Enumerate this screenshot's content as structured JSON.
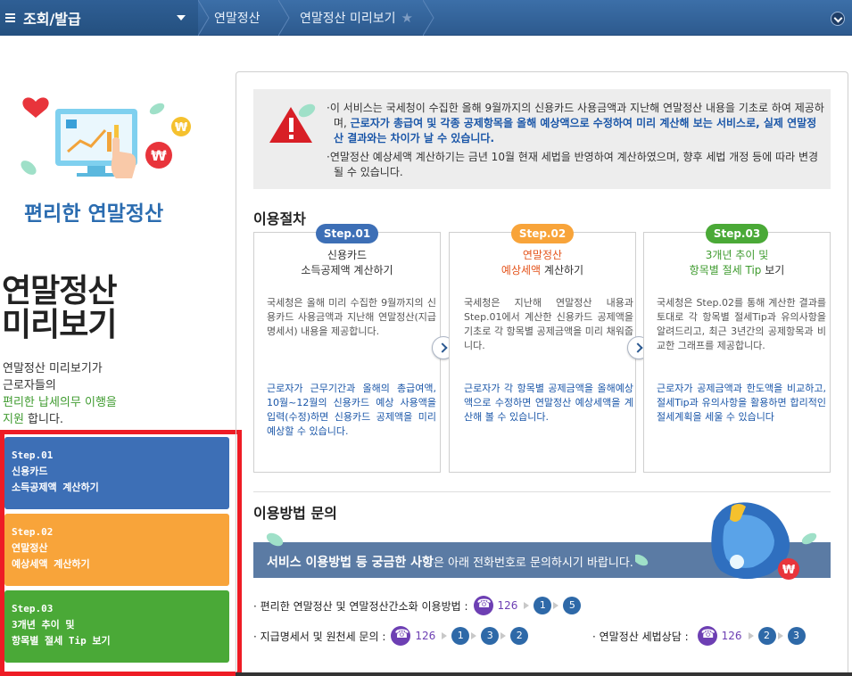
{
  "topbar": {
    "menu_title": "조회/발급",
    "breadcrumbs": [
      "연말정산",
      "연말정산 미리보기"
    ]
  },
  "left": {
    "subtitle": "편리한 연말정산",
    "title_line1": "연말정산",
    "title_line2": "미리보기",
    "desc_line1": "연말정산 미리보기가",
    "desc_line2": "근로자들의",
    "desc_green1": "편리한 납세의무 이행을",
    "desc_green2": "지원",
    "desc_end": " 합니다.",
    "steps": [
      {
        "l1": "Step.01",
        "l2": "신용카드",
        "l3": "소득공제액 계산하기"
      },
      {
        "l1": "Step.02",
        "l2": "연말정산",
        "l3": "예상세액 계산하기"
      },
      {
        "l1": "Step.03",
        "l2": "3개년 추이 및",
        "l3": "항목별 절세 Tip 보기"
      }
    ]
  },
  "notice": {
    "p1a": "이 서비스는 국세청이 수집한 올해 9월까지의 신용카드 사용금액과 지난해 연말정산 내용을 기초로 하여 제공하며, ",
    "p1b": "근로자가 총급여 및 각종 공제항목을 올해 예상액으로 수정하여 미리 계산해 보는 서비스로, 실제 연말정산 결과와는 차이가 날 수 있습니다.",
    "p2": "연말정산 예상세액 계산하기는 금년 10월 현재 세법을 반영하여 계산하였으며, 향후 세법 개정 등에 따라 변경될 수 있습니다."
  },
  "procedure": {
    "title": "이용절차",
    "cards": [
      {
        "pill": "Step.01",
        "head1": "신용카드",
        "head2": "소득공제액 계산하기",
        "body": "국세청은 올해 미리 수집한 9월까지의 신용카드 사용금액과 지난해 연말정산(지급명세서) 내용을 제공합니다.",
        "blue": "근로자가 근무기간과 올해의 총급여액, 10월~12월의 신용카드 예상 사용액을 입력(수정)하면 신용카드 공제액을 미리 예상할 수 있습니다."
      },
      {
        "pill": "Step.02",
        "head1": "연말정산",
        "head2a": "예상세액",
        "head2b": " 계산하기",
        "body": "국세청은 지난해 연말정산 내용과 Step.01에서 계산한 신용카드 공제액을 기초로 각 항목별 공제금액을 미리 채워줍니다.",
        "blue": "근로자가 각 항목별 공제금액을 올해예상액으로 수정하면 연말정산 예상세액을 계산해 볼 수 있습니다."
      },
      {
        "pill": "Step.03",
        "head1": "3개년 추이 및",
        "head2a": "항목별 절세 Tip",
        "head2b": " 보기",
        "body": "국세청은 Step.02를 통해 계산한 결과를 토대로 각 항목별 절세Tip과 유의사항을 알려드리고, 최근 3년간의 공제항목과 비교한 그래프를 제공합니다.",
        "blue": "근로자가 공제금액과 한도액을 비교하고, 절세Tip과 유의사항을 활용하면 합리적인 절세계획을 세울 수 있습니다"
      }
    ]
  },
  "inquiry": {
    "title": "이용방법 문의",
    "banner_bold": "서비스 이용방법 등 궁금한 사항",
    "banner_rest": "은 아래 전화번호로 문의하시기 바랍니다.",
    "rows": [
      {
        "label": "· 편리한 연말정산 및 연말정산간소화 이용방법 :",
        "number": "126",
        "keys": [
          "1",
          "5"
        ]
      },
      {
        "label": "· 지급명세서 및 원천세 문의 :",
        "number": "126",
        "keys": [
          "1",
          "3",
          "2"
        ]
      },
      {
        "label": "· 연말정산 세법상담 :",
        "number": "126",
        "keys": [
          "2",
          "3"
        ]
      }
    ]
  },
  "colors": {
    "step1": "#3d6fb6",
    "step2": "#f8a43a",
    "step3": "#4aa937",
    "highlight_border": "#ee1c25",
    "topbar": "#2d5a8e"
  }
}
